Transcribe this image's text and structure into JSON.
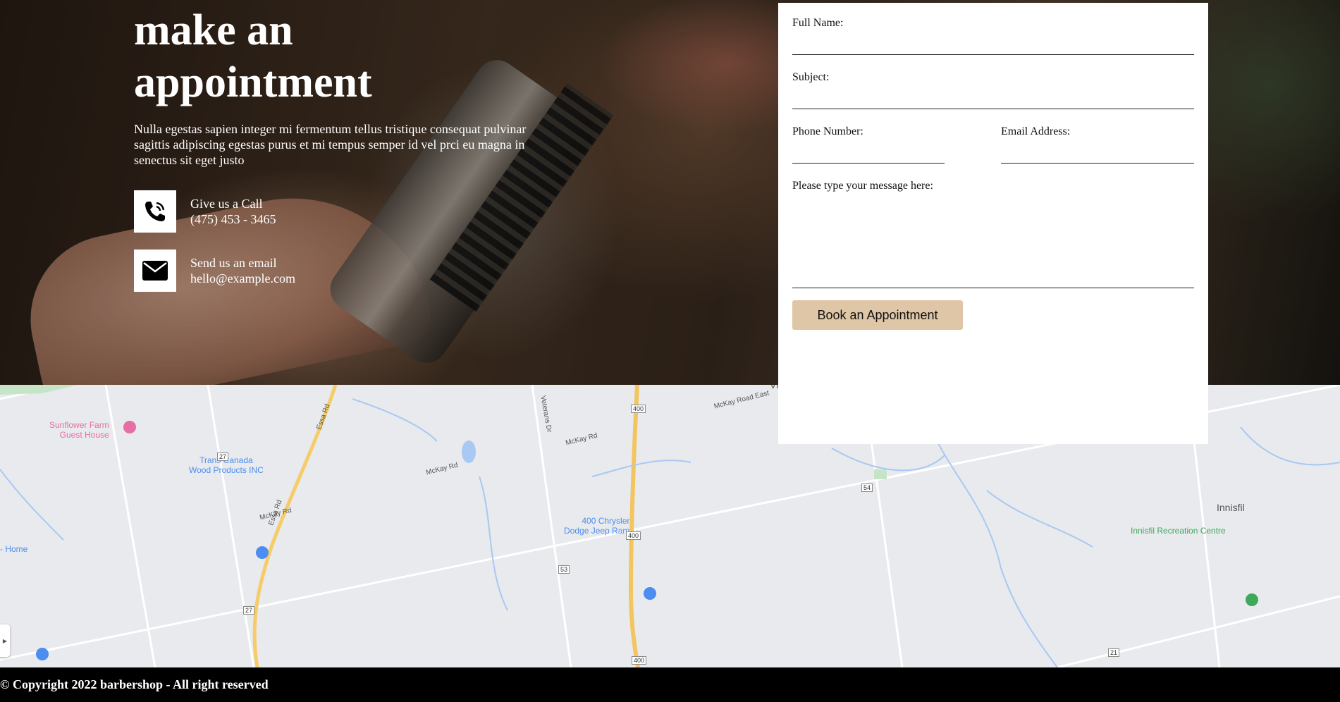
{
  "hero": {
    "title_line1": "make an",
    "title_line2": "appointment",
    "description": "Nulla egestas sapien integer mi fermentum tellus tristique consequat pulvinar sagittis adipiscing egestas purus et mi tempus semper id vel prci eu magna in senectus sit eget justo",
    "call": {
      "label": "Give us a Call",
      "value": "(475) 453 - 3465",
      "icon": "phone-icon"
    },
    "email": {
      "label": "Send us an email",
      "value": "hello@example.com",
      "icon": "envelope-icon"
    }
  },
  "form": {
    "full_name_label": "Full Name:",
    "subject_label": "Subject:",
    "phone_label": "Phone Number:",
    "email_label": "Email Address:",
    "message_label": "Please type your message here:",
    "submit_label": "Book an Appointment"
  },
  "map": {
    "labels": {
      "sunflower_line1": "Sunflower Farm",
      "sunflower_line2": "Guest House",
      "trans_canada_line1": "Trans Canada",
      "trans_canada_line2": "Wood Products INC",
      "chrysler_line1": "400 Chrysler",
      "chrysler_line2": "Dodge Jeep Ram",
      "vine": "Vine",
      "innisfil": "Innisfil",
      "innisfil_rec": "Innisfil Recreation Centre",
      "home": "Home",
      "essa_rd": "Essa Rd",
      "essa_rd_2": "Essa Rd",
      "veterans_dr": "Veterans Dr",
      "mckay_rd_east": "McKay Road East",
      "mckay_rd_1": "McKay Rd",
      "mckay_rd_2": "McKay Rd",
      "mckay_rd_3": "McKay Rd",
      "shield_400_top": "400",
      "shield_400_mid": "400",
      "shield_400_bottom": "400",
      "shield_27_top": "27",
      "shield_27_bottom": "27",
      "shield_53": "53",
      "shield_54": "54",
      "shield_21": "21"
    }
  },
  "footer": {
    "copyright": "© Copyright 2022 barbershop - All right reserved"
  },
  "colors": {
    "button_bg": "#dfc6a6",
    "form_bg": "#ffffff",
    "footer_bg": "#000000",
    "map_bg": "#e8eaed"
  }
}
